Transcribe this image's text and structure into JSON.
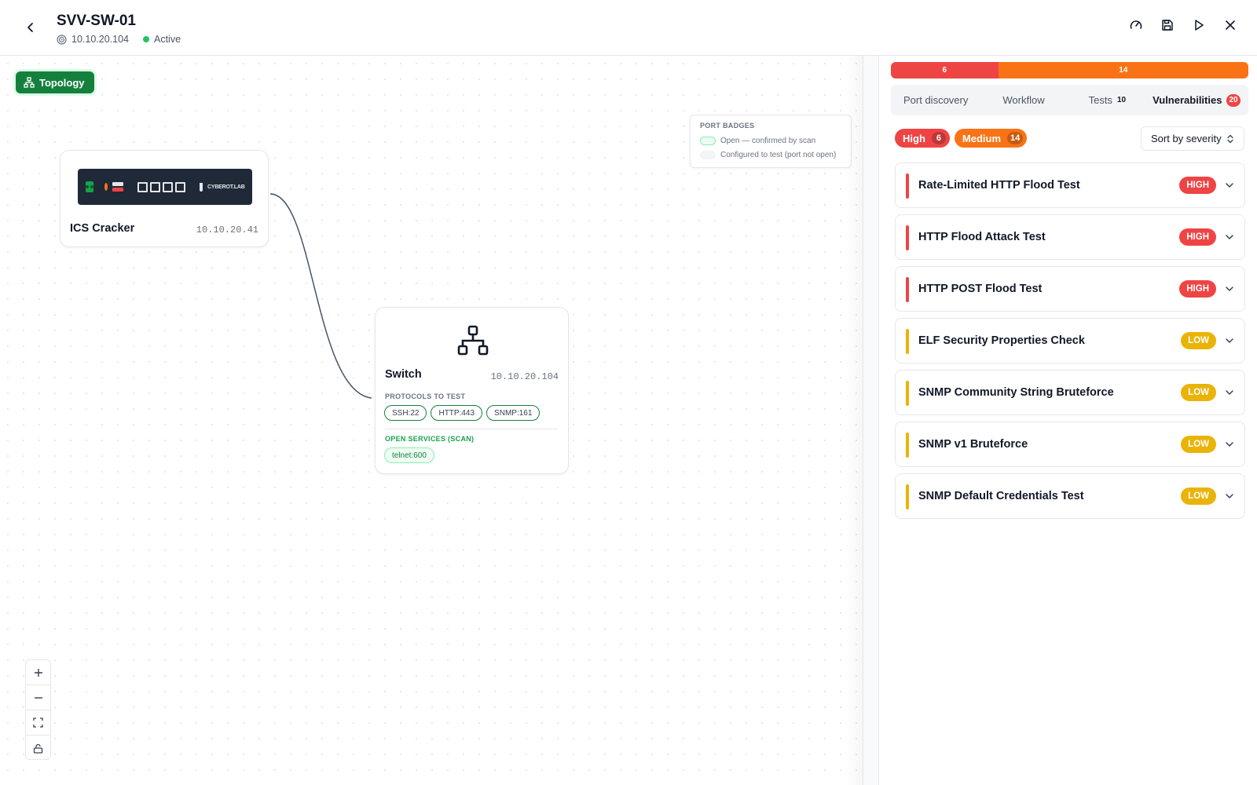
{
  "header": {
    "title": "SVV-SW-01",
    "ip": "10.10.20.104",
    "status": "Active"
  },
  "canvas": {
    "topology_label": "Topology",
    "legend": {
      "title": "PORT BADGES",
      "open_label": "Open — confirmed by scan",
      "configured_label": "Configured to test (port not open)"
    },
    "nodes": {
      "ics": {
        "name": "ICS Cracker",
        "ip": "10.10.20.41",
        "brand": "CYBEROT.LAB"
      },
      "switch": {
        "name": "Switch",
        "ip": "10.10.20.104",
        "protocols_label": "PROTOCOLS TO TEST",
        "protocols": [
          "SSH:22",
          "HTTP:443",
          "SNMP:161"
        ],
        "open_label": "OPEN SERVICES (SCAN)",
        "open_services": [
          "telnet:600"
        ]
      }
    }
  },
  "panel": {
    "severity_bar": {
      "high": 6,
      "medium": 14
    },
    "tabs": [
      {
        "label": "Port discovery"
      },
      {
        "label": "Workflow"
      },
      {
        "label": "Tests",
        "count": "10"
      },
      {
        "label": "Vulnerabilities",
        "count": "20"
      }
    ],
    "filters": [
      {
        "label": "High",
        "count": "6",
        "color": "#ef4444"
      },
      {
        "label": "Medium",
        "count": "14",
        "color": "#f97316"
      }
    ],
    "sort_label": "Sort by severity",
    "vulnerabilities": [
      {
        "name": "Rate-Limited HTTP Flood Test",
        "severity": "HIGH"
      },
      {
        "name": "HTTP Flood Attack Test",
        "severity": "HIGH"
      },
      {
        "name": "HTTP POST Flood Test",
        "severity": "HIGH"
      },
      {
        "name": "ELF Security Properties Check",
        "severity": "LOW"
      },
      {
        "name": "SNMP Community String Bruteforce",
        "severity": "LOW"
      },
      {
        "name": "SNMP v1 Bruteforce",
        "severity": "LOW"
      },
      {
        "name": "SNMP Default Credentials Test",
        "severity": "LOW"
      }
    ]
  },
  "colors": {
    "high": "#ef4444",
    "medium": "#f97316",
    "low": "#eab308",
    "accent_green": "#15803d",
    "status_active": "#22c55e"
  },
  "icons": [
    "chevron-left-icon",
    "target-icon",
    "gauge-icon",
    "save-icon",
    "play-icon",
    "close-icon",
    "topology-icon",
    "network-switch-icon",
    "plus-icon",
    "minus-icon",
    "fit-view-icon",
    "lock-icon",
    "chevron-down-icon",
    "sort-icon"
  ]
}
